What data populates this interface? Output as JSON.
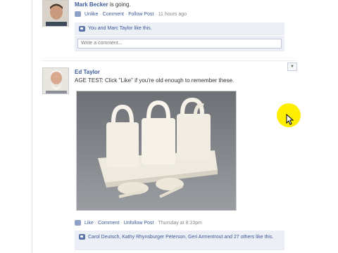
{
  "post1": {
    "author": "Mark Becker",
    "status": "is going.",
    "actions": {
      "unlike": "Unlike",
      "comment": "Comment",
      "follow": "Follow Post",
      "time": "11 hours ago",
      "sep": "·"
    },
    "likes_text": "You and Marc Taylor like this.",
    "comment_placeholder": "Write a comment..."
  },
  "post2": {
    "author": "Ed Taylor",
    "message": "AGE TEST: Click \"Like\" if you're old enough to remember these.",
    "actions": {
      "like": "Like",
      "comment": "Comment",
      "unfollow": "Unfollow Post",
      "time": "Thursday at 8:10pm",
      "sep": "·"
    },
    "likes_text": "Carol Deutsch, Kathy Rhynsburger Peterson, Geri Armentrout and 27 others like this."
  },
  "colors": {
    "link": "#3b5998",
    "like_box_bg": "#eceff5",
    "cursor_highlight": "#ffee00"
  },
  "icons": {
    "post_menu": "chevron-down-icon",
    "cursor": "mouse-pointer-icon"
  }
}
